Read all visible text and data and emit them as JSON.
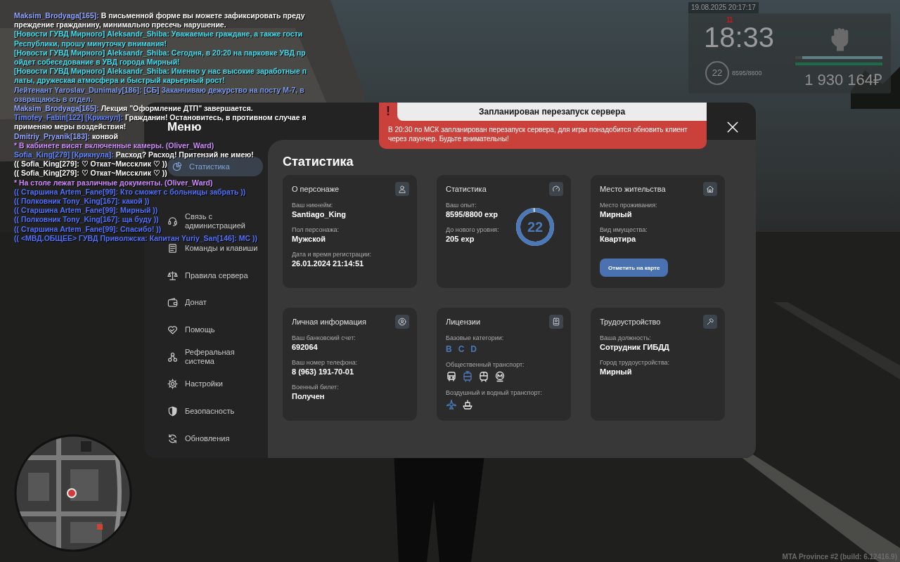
{
  "chat": [
    {
      "segments": [
        {
          "text": "Maksim_Brodyaga[165]:",
          "color": "#8fa5ff"
        },
        {
          "text": " В письменной форме вы можете зафиксировать преду",
          "color": "#ffffff"
        }
      ]
    },
    {
      "segments": [
        {
          "text": "преждение гражданину, минимально пресечь нарушение.",
          "color": "#ffffff"
        }
      ]
    },
    {
      "segments": [
        {
          "text": "[Новости ГУВД Мирного] Aleksandr_Shiba: Уважаемые граждане, а также гости",
          "color": "#3fe0f0"
        }
      ]
    },
    {
      "segments": [
        {
          "text": "Республики, прошу минуточку внимания!",
          "color": "#3fe0f0"
        }
      ]
    },
    {
      "segments": [
        {
          "text": "[Новости ГУВД Мирного] Aleksandr_Shiba: Сегодня, в 20:20 на парковке УВД пр",
          "color": "#3fe0f0"
        }
      ]
    },
    {
      "segments": [
        {
          "text": "ойдет собеседование в УВД города Мирный!",
          "color": "#3fe0f0"
        }
      ]
    },
    {
      "segments": [
        {
          "text": "[Новости ГУВД Мирного] Aleksandr_Shiba: Именно у нас высокие заработные п",
          "color": "#3fe0f0"
        }
      ]
    },
    {
      "segments": [
        {
          "text": "латы, дружеская атмосфера и быстрый карьерный рост!",
          "color": "#3fe0f0"
        }
      ]
    },
    {
      "segments": [
        {
          "text": "Лейтенант Yaroslav_Dunimaly[186]: [СБ] Заканчиваю дежурство на посту М-7, в",
          "color": "#7b9bf0"
        }
      ]
    },
    {
      "segments": [
        {
          "text": "озвращаюсь в отдел.",
          "color": "#7b9bf0"
        }
      ]
    },
    {
      "segments": [
        {
          "text": "Maksim_Brodyaga[165]:",
          "color": "#8fa5ff"
        },
        {
          "text": " Лекция \"Оформление ДТП\" завершается.",
          "color": "#ffffff"
        }
      ]
    },
    {
      "segments": [
        {
          "text": "Timofey_Fabin[122] [Крикнул]:",
          "color": "#5f86ff"
        },
        {
          "text": " Гражданин! Остановитесь, в противном случае я",
          "color": "#ffffff"
        }
      ]
    },
    {
      "segments": [
        {
          "text": "применяю меры воздействия!",
          "color": "#ffffff"
        }
      ]
    },
    {
      "segments": [
        {
          "text": "Dmitriy_Pryanik[183]:",
          "color": "#8fa5ff"
        },
        {
          "text": " конвой",
          "color": "#ffffff"
        }
      ]
    },
    {
      "segments": [
        {
          "text": "* В кабинете висят включенные камеры. (Oliver_Ward)",
          "color": "#d08cff"
        }
      ]
    },
    {
      "segments": [
        {
          "text": "Sofia_King[279] [Крикнула]:",
          "color": "#5f86ff"
        },
        {
          "text": " Расход? Расход! Притензий не имею!",
          "color": "#ffffff"
        }
      ]
    },
    {
      "segments": [
        {
          "text": "(( Sofia_King[279]: ♡ Откат~Миссклик ♡ ))",
          "color": "#ffffff"
        }
      ]
    },
    {
      "segments": [
        {
          "text": "(( Sofia_King[279]: ♡ Откат~Миссклик ♡ ))",
          "color": "#ffffff"
        }
      ]
    },
    {
      "segments": [
        {
          "text": "* На столе лежат различные документы. (Oliver_Ward)",
          "color": "#d08cff"
        }
      ]
    },
    {
      "segments": [
        {
          "text": "(( Старшина Artem_Fane[99]: Кто сможет с больницы забрать ))",
          "color": "#4f72ff"
        }
      ]
    },
    {
      "segments": [
        {
          "text": "(( Полковник Tony_King[167]: какой ))",
          "color": "#4f72ff"
        }
      ]
    },
    {
      "segments": [
        {
          "text": "(( Старшина Artem_Fane[99]: Мирный ))",
          "color": "#4f72ff"
        }
      ]
    },
    {
      "segments": [
        {
          "text": "(( Полковник Tony_King[167]: ща буду ))",
          "color": "#4f72ff"
        }
      ]
    },
    {
      "segments": [
        {
          "text": "(( Старшина Artem_Fane[99]: Спасибо! ))",
          "color": "#4f72ff"
        }
      ]
    },
    {
      "segments": [
        {
          "text": "(( <МВД.ОБЩЕЕ> ГУВД Приволжска: Капитан Yuriy_San[146]: МС ))",
          "color": "#4f72ff"
        }
      ]
    }
  ],
  "hud": {
    "date": "19.08.2025 20:17:17",
    "wanted": "11",
    "time": "18:33",
    "level": "22",
    "experience": "8595/8800",
    "money": "1 930 164₽",
    "bars": [
      {
        "color": "#5e7f84",
        "level": 0.92
      },
      {
        "color": "#1d6b48",
        "level": 1
      }
    ]
  },
  "menu": {
    "title": "Меню",
    "sidebar": {
      "items": [
        {
          "label": "Статистика",
          "selected": true
        },
        {
          "label": "Связь с администрацией",
          "selected": false
        },
        {
          "label": "Команды и клавиши",
          "selected": false
        },
        {
          "label": "Правила сервера",
          "selected": false
        },
        {
          "label": "Донат",
          "selected": false
        },
        {
          "label": "Помощь",
          "selected": false
        },
        {
          "label": "Реферальная система",
          "selected": false
        },
        {
          "label": "Настройки",
          "selected": false
        },
        {
          "label": "Безопасность",
          "selected": false
        },
        {
          "label": "Обновления",
          "selected": false
        }
      ]
    },
    "content": {
      "title": "Статистика",
      "cards": [
        {
          "kind": "fields",
          "title": "О персонаже",
          "fields": [
            {
              "label": "Ваш никнейм:",
              "value": "Santiago_King"
            },
            {
              "label": "Пол персонажа:",
              "value": "Мужской"
            },
            {
              "label": "Дата и время регистрации:",
              "value": "26.01.2024 21:14:51"
            }
          ]
        },
        {
          "kind": "experience",
          "title": "Статистика",
          "fields": [
            {
              "label": "Ваш опыт:",
              "value": "8595/8800 exp"
            },
            {
              "label": "До нового уровня:",
              "value": "205 exp"
            }
          ],
          "ring": {
            "value": "22",
            "level": 0.977
          }
        },
        {
          "kind": "fields",
          "title": "Место жительства",
          "fields": [
            {
              "label": "Место проживания:",
              "value": "Мирный"
            },
            {
              "label": "Вид имущества:",
              "value": "Квартира"
            }
          ],
          "button": "Отметить на карте"
        },
        {
          "kind": "fields",
          "title": "Личная информация",
          "fields": [
            {
              "label": "Ваш банковский счет:",
              "value": "692064"
            },
            {
              "label": "Ваш номер телефона:",
              "value": "8 (963) 191-70-01"
            },
            {
              "label": "Военный билет:",
              "value": "Получен"
            }
          ]
        },
        {
          "kind": "licenses",
          "title": "Лицензии",
          "groups": [
            {
              "kind": "categories",
              "label": "Базовые категории:",
              "categories": [
                "B",
                "C",
                "D"
              ]
            },
            {
              "kind": "vehicles",
              "label": "Общественный транспорт:",
              "vehicles": [
                {
                  "highlighted": false
                },
                {
                  "highlighted": true
                },
                {
                  "highlighted": false
                },
                {
                  "highlighted": false
                }
              ]
            },
            {
              "kind": "vehicles",
              "label": "Воздушный и водный транспорт:",
              "vehicles": [
                {
                  "highlighted": true
                },
                {
                  "highlighted": false
                }
              ]
            }
          ]
        },
        {
          "kind": "fields",
          "title": "Трудоустройство",
          "fields": [
            {
              "label": "Ваша должность:",
              "value": "Сотрудник ГИБДД"
            },
            {
              "label": "Город трудоустройства:",
              "value": "Мирный"
            }
          ]
        }
      ]
    }
  },
  "notification": {
    "mark": "!",
    "title": "Запланирован перезапуск сервера",
    "body": "В 20:30 по МСК запланирован перезапуск сервера, для игры понадобится обновить клиент через лаунчер. Будьте внимательны!"
  },
  "build": "MTA Province #2 (build: 6.12416.9)"
}
